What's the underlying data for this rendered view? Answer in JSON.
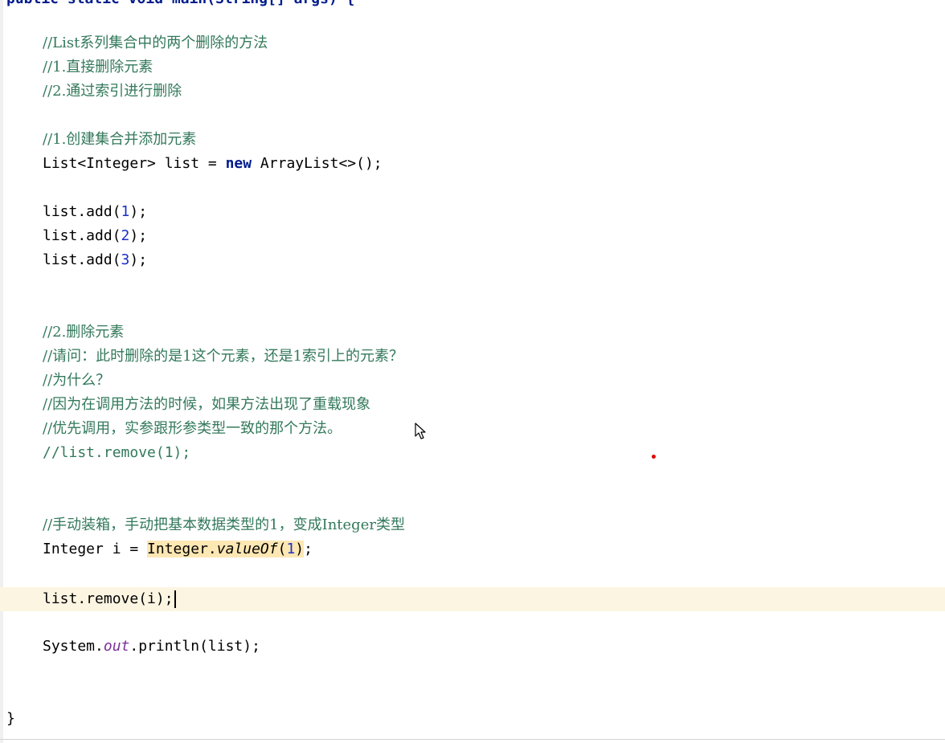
{
  "editor": {
    "header_partial": "public static void main(String[] args) {",
    "comments": {
      "c1": "//List系列集合中的两个删除的方法",
      "c2": "//1.直接删除元素",
      "c3": "//2.通过索引进行删除",
      "c4": "//1.创建集合并添加元素",
      "c5": "//2.删除元素",
      "c6": "//请问：此时删除的是1这个元素，还是1索引上的元素？",
      "c7": "//为什么？",
      "c8": "//因为在调用方法的时候，如果方法出现了重载现象",
      "c9": "//优先调用，实参跟形参类型一致的那个方法。",
      "c10": "//list.remove(1);",
      "c11": "//手动装箱，手动把基本数据类型的1，变成Integer类型"
    },
    "code": {
      "decl_type": "List<Integer> list = ",
      "decl_new": "new",
      "decl_rest": " ArrayList<>();",
      "add_prefix": "list.add(",
      "add_suffix": ");",
      "add1": "1",
      "add2": "2",
      "add3": "3",
      "int_decl": "Integer i = ",
      "int_call_a": "Integer.",
      "int_call_b": "valueOf",
      "int_call_c": "(",
      "int_call_num": "1",
      "int_call_d": ")",
      "int_semi": ";",
      "remove_line": "list.remove(i);",
      "print_a": "System.",
      "print_out": "out",
      "print_b": ".println(list);",
      "close_brace": "}"
    }
  }
}
